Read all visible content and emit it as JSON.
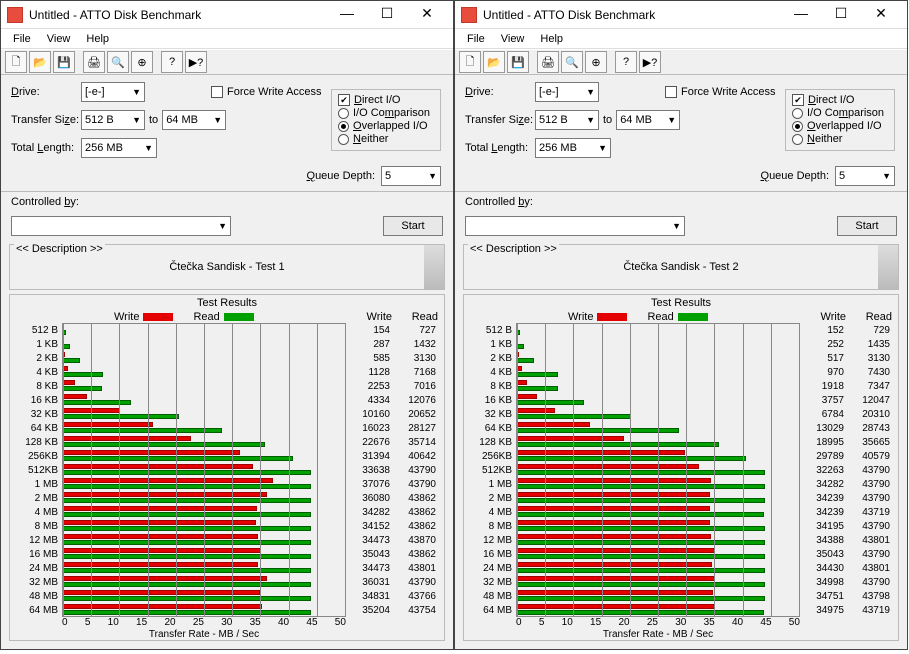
{
  "app_title": "Untitled - ATTO Disk Benchmark",
  "menu": {
    "file": "File",
    "view": "View",
    "help": "Help"
  },
  "toolbar": {
    "icons": [
      "new",
      "open",
      "save",
      "print",
      "print-preview",
      "zoom",
      "about",
      "help",
      "context-help"
    ]
  },
  "labels": {
    "drive": "Drive:",
    "transfer_size": "Transfer Size:",
    "to": "to",
    "total_length": "Total Length:",
    "force_write": "Force Write Access",
    "direct_io": "Direct I/O",
    "io_comparison": "I/O Comparison",
    "overlapped_io": "Overlapped I/O",
    "neither": "Neither",
    "queue_depth": "Queue Depth:",
    "controlled_by": "Controlled by:",
    "start": "Start",
    "description_legend": "<< Description >>",
    "test_results": "Test Results",
    "write": "Write",
    "read": "Read",
    "xaxis": "Transfer Rate - MB / Sec"
  },
  "settings": {
    "drive": "[-e-]",
    "size_from": "512 B",
    "size_to": "64 MB",
    "total_length": "256 MB",
    "force_write": false,
    "direct_io": true,
    "radio_selected": "overlapped_io",
    "queue_depth": "5",
    "controlled_by": ""
  },
  "panes": [
    {
      "description": "Čtečka Sandisk - Test 1"
    },
    {
      "description": "Čtečka Sandisk - Test 2"
    }
  ],
  "chart_data": [
    {
      "type": "bar",
      "orientation": "horizontal",
      "title": "Test Results",
      "xlabel": "Transfer Rate - MB / Sec",
      "xlim": [
        0,
        50
      ],
      "xticks": [
        0,
        5,
        10,
        15,
        20,
        25,
        30,
        35,
        40,
        45,
        50
      ],
      "scale": 1000,
      "categories": [
        "512 B",
        "1 KB",
        "2 KB",
        "4 KB",
        "8 KB",
        "16 KB",
        "32 KB",
        "64 KB",
        "128 KB",
        "256KB",
        "512KB",
        "1 MB",
        "2 MB",
        "4 MB",
        "8 MB",
        "12 MB",
        "16 MB",
        "24 MB",
        "32 MB",
        "48 MB",
        "64 MB"
      ],
      "series": [
        {
          "name": "Write",
          "color": "#e40000",
          "values": [
            154,
            287,
            585,
            1128,
            2253,
            4334,
            10160,
            16023,
            22676,
            31394,
            33638,
            37076,
            36080,
            34282,
            34152,
            34473,
            35043,
            34473,
            36031,
            34831,
            35204
          ]
        },
        {
          "name": "Read",
          "color": "#00a000",
          "values": [
            727,
            1432,
            3130,
            7168,
            7016,
            12076,
            20652,
            28127,
            35714,
            40642,
            43790,
            43790,
            43862,
            43862,
            43862,
            43870,
            43862,
            43801,
            43790,
            43766,
            43754
          ]
        }
      ]
    },
    {
      "type": "bar",
      "orientation": "horizontal",
      "title": "Test Results",
      "xlabel": "Transfer Rate - MB / Sec",
      "xlim": [
        0,
        50
      ],
      "xticks": [
        0,
        5,
        10,
        15,
        20,
        25,
        30,
        35,
        40,
        45,
        50
      ],
      "scale": 1000,
      "categories": [
        "512 B",
        "1 KB",
        "2 KB",
        "4 KB",
        "8 KB",
        "16 KB",
        "32 KB",
        "64 KB",
        "128 KB",
        "256KB",
        "512KB",
        "1 MB",
        "2 MB",
        "4 MB",
        "8 MB",
        "12 MB",
        "16 MB",
        "24 MB",
        "32 MB",
        "48 MB",
        "64 MB"
      ],
      "series": [
        {
          "name": "Write",
          "color": "#e40000",
          "values": [
            152,
            252,
            517,
            970,
            1918,
            3757,
            6784,
            13029,
            18995,
            29789,
            32263,
            34282,
            34239,
            34239,
            34195,
            34388,
            35043,
            34430,
            34998,
            34751,
            34975
          ]
        },
        {
          "name": "Read",
          "color": "#00a000",
          "values": [
            729,
            1435,
            3130,
            7430,
            7347,
            12047,
            20310,
            28743,
            35665,
            40579,
            43790,
            43790,
            43790,
            43719,
            43790,
            43801,
            43790,
            43801,
            43790,
            43798,
            43719
          ]
        }
      ]
    }
  ]
}
